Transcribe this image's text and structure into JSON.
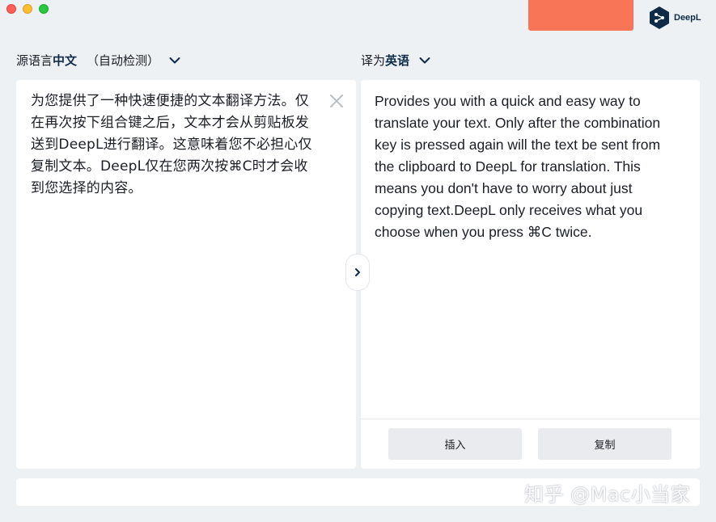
{
  "window": {
    "traffic_lights": [
      "close",
      "minimize",
      "zoom"
    ]
  },
  "brand": {
    "name": "DeepL",
    "color": "#0f2b46",
    "promo_color": "#f87558"
  },
  "source": {
    "label_prefix": "源语言",
    "language": "中文",
    "detect_note": "（自动检测）",
    "text": "为您提供了一种快速便捷的文本翻译方法。仅\n在再次按下组合键之后，文本才会从剪贴板发\n送到DeepL进行翻译。这意味着您不必担心仅\n复制文本。DeepL仅在您两次按⌘C时才会收\n到您选择的内容。"
  },
  "target": {
    "label_prefix": "译为",
    "language": "英语",
    "text": "Provides you with a quick and easy way to\ntranslate your text. Only after the combination\nkey is pressed again will the text be sent from\nthe clipboard to DeepL for translation. This\nmeans you don't have to worry about just\ncopying text.DeepL only receives what you\nchoose when you press ⌘C twice."
  },
  "actions": {
    "insert_label": "插入",
    "copy_label": "复制"
  },
  "watermark": "知乎 @Mac小当家"
}
